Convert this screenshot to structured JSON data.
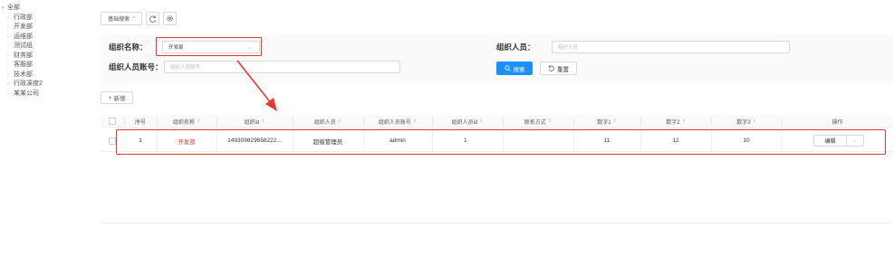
{
  "tree": {
    "root": "全部",
    "items": [
      "行政部",
      "开发部",
      "运维部",
      "测试组",
      "财务部",
      "客服部",
      "技术部",
      "行政凑度2",
      "某某公司"
    ]
  },
  "toolbar": {
    "basic_search": "基础搜索",
    "basic_search_arrow": "^",
    "refresh_icon": "refresh-icon",
    "settings_icon": "gear-icon"
  },
  "search": {
    "org_name_label": "组织名称：",
    "org_name_value": "开发部",
    "org_person_label": "组织人员：",
    "org_person_placeholder": "组织人员",
    "org_account_label": "组织人员账号：",
    "org_account_placeholder": "组织人员账号",
    "search_button": "搜索",
    "reset_button": "重置"
  },
  "actions": {
    "add": "新增"
  },
  "table": {
    "columns": [
      "序号",
      "组织名称",
      "组织id",
      "组织人员",
      "组织人员账号",
      "组织人员id",
      "联系方式",
      "数字1",
      "数字2",
      "数字3",
      "操作"
    ],
    "rows": [
      [
        "1",
        "开发部",
        "149309829658222...",
        "超级管理员",
        "admin",
        "1",
        "",
        "11",
        "12",
        "10"
      ]
    ],
    "edit_label": "编辑"
  },
  "colors": {
    "accent": "#1890ff",
    "highlight": "#e53935"
  }
}
